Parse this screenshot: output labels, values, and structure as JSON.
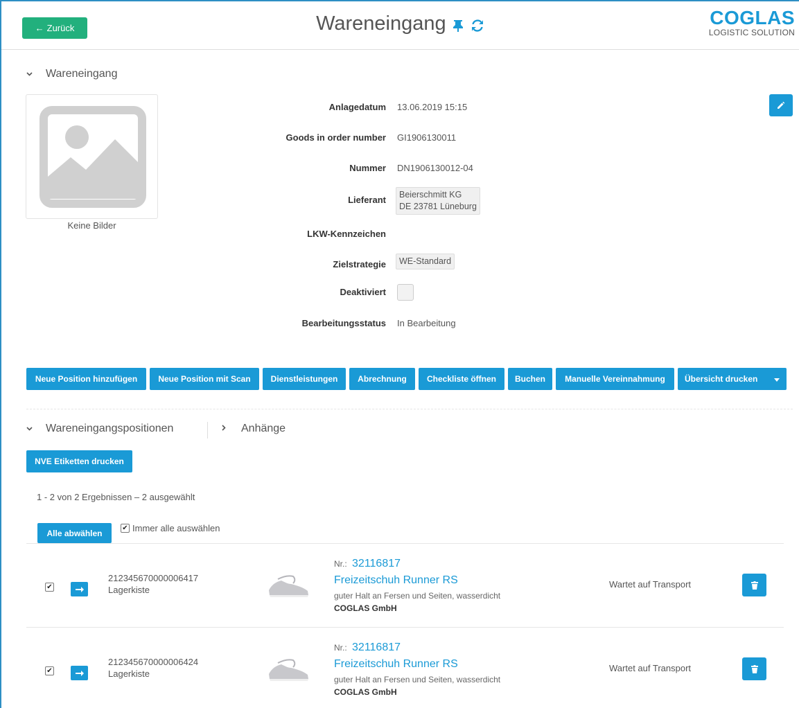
{
  "header": {
    "back_label": "Zurück",
    "title": "Wareneingang",
    "logo_main": "COGLAS",
    "logo_sub": "LOGISTIC SOLUTION"
  },
  "details": {
    "section_title": "Wareneingang",
    "image_caption": "Keine Bilder",
    "fields": {
      "created_label": "Anlagedatum",
      "created_value": "13.06.2019 15:15",
      "order_label": "Goods in order number",
      "order_value": "GI1906130011",
      "number_label": "Nummer",
      "number_value": "DN1906130012-04",
      "supplier_label": "Lieferant",
      "supplier_line1": "Beierschmitt KG",
      "supplier_line2": "DE 23781 Lüneburg",
      "truck_label": "LKW-Kennzeichen",
      "strategy_label": "Zielstrategie",
      "strategy_value": "WE-Standard",
      "deactivated_label": "Deaktiviert",
      "status_label": "Bearbeitungsstatus",
      "status_value": "In Bearbeitung"
    }
  },
  "toolbar": {
    "add_position": "Neue Position hinzufügen",
    "add_scan": "Neue Position mit Scan",
    "services": "Dienstleistungen",
    "billing": "Abrechnung",
    "checklist": "Checkliste öffnen",
    "book": "Buchen",
    "manual": "Manuelle Vereinnahmung",
    "print": "Übersicht drucken"
  },
  "positions": {
    "tab_positions": "Wareneingangspositionen",
    "tab_attachments": "Anhänge",
    "nve_print": "NVE Etiketten drucken",
    "result_count": "1 - 2 von 2 Ergebnissen  –  2 ausgewählt",
    "deselect_all": "Alle abwählen",
    "always_select": "Immer alle auswählen",
    "rows": [
      {
        "nve": "212345670000006417",
        "type": "Lagerkiste",
        "nr_label": "Nr.:",
        "nr_value": "32116817",
        "name": "Freizeitschuh Runner RS",
        "description": "guter Halt an Fersen und Seiten, wasserdicht",
        "company": "COGLAS GmbH",
        "status": "Wartet auf Transport"
      },
      {
        "nve": "212345670000006424",
        "type": "Lagerkiste",
        "nr_label": "Nr.:",
        "nr_value": "32116817",
        "name": "Freizeitschuh Runner RS",
        "description": "guter Halt an Fersen und Seiten, wasserdicht",
        "company": "COGLAS GmbH",
        "status": "Wartet auf Transport"
      }
    ]
  },
  "colors": {
    "primary": "#1a9ad6",
    "back_button": "#22b07d",
    "frame": "#2e8fc4"
  }
}
